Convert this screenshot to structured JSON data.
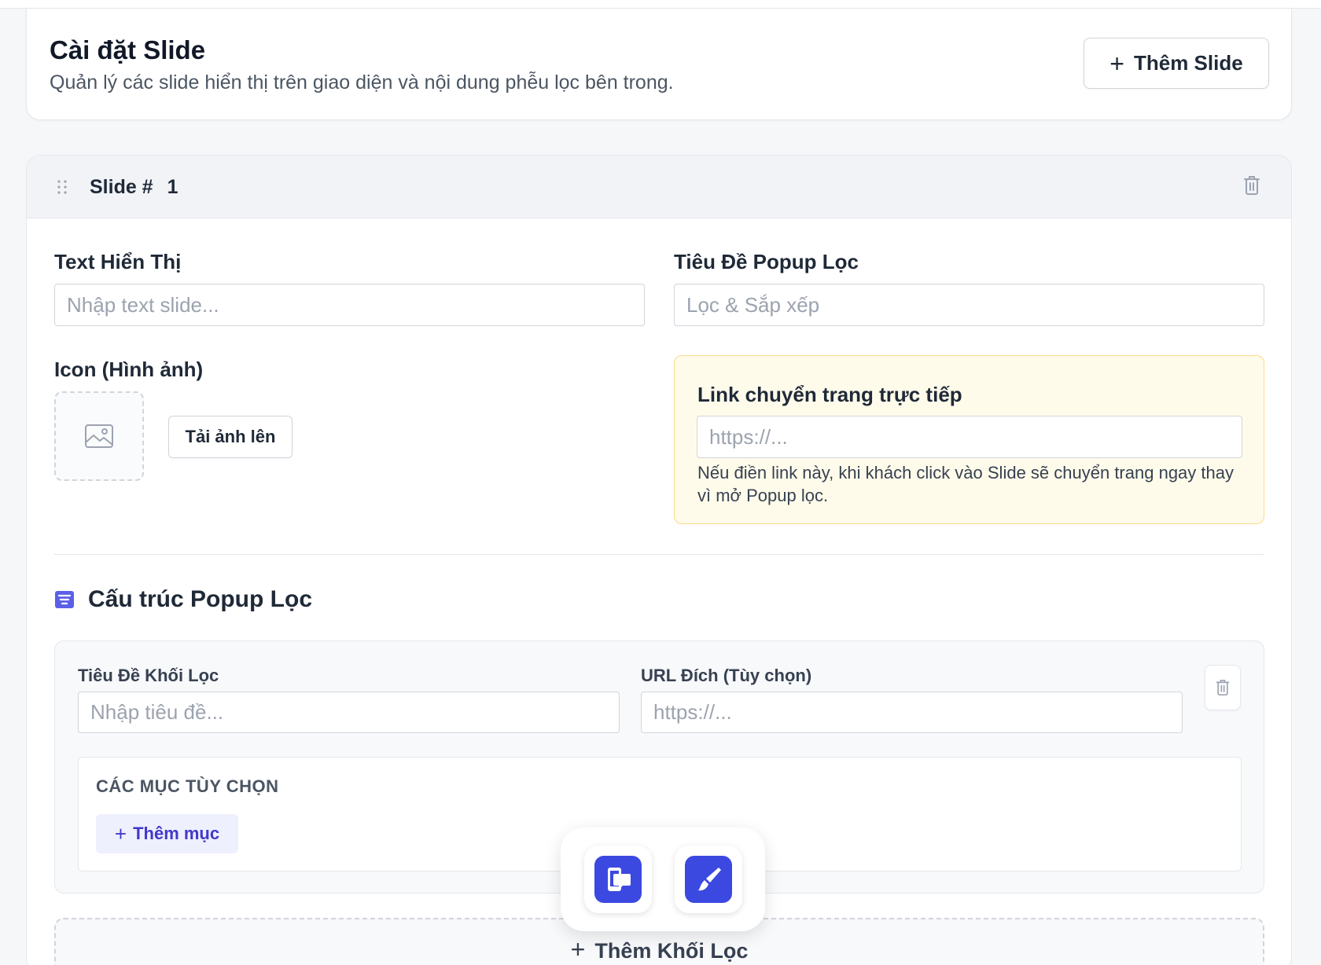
{
  "header": {
    "title": "Cài đặt Slide",
    "subtitle": "Quản lý các slide hiển thị trên giao diện và nội dung phễu lọc bên trong.",
    "add_slide_label": "Thêm Slide"
  },
  "slide": {
    "label": "Slide #",
    "number": "1",
    "text_label": "Text Hiển Thị",
    "text_placeholder": "Nhập text slide...",
    "popup_title_label": "Tiêu Đề Popup Lọc",
    "popup_title_placeholder": "Lọc & Sắp xếp",
    "icon_label": "Icon (Hình ảnh)",
    "upload_label": "Tải ảnh lên",
    "link": {
      "title": "Link chuyển trang trực tiếp",
      "placeholder": "https://...",
      "note": "Nếu điền link này, khi khách click vào Slide sẽ chuyển trang ngay thay vì mở Popup lọc."
    }
  },
  "popup_structure": {
    "title": "Cấu trúc Popup Lọc",
    "block": {
      "title_label": "Tiêu Đề Khối Lọc",
      "title_placeholder": "Nhập tiêu đề...",
      "url_label": "URL Đích (Tùy chọn)",
      "url_placeholder": "https://...",
      "options_label": "CÁC MỤC TÙY CHỌN",
      "add_item_label": "Thêm mục"
    },
    "add_block_label": "Thêm Khối Lọc"
  },
  "dock": {
    "items": [
      "phone-chat-icon",
      "brush-icon"
    ]
  },
  "colors": {
    "accent": "#3b49e0",
    "accent_soft": "#eef0fe",
    "warning_bg": "#fffbeb",
    "warning_border": "#fcd98a"
  }
}
